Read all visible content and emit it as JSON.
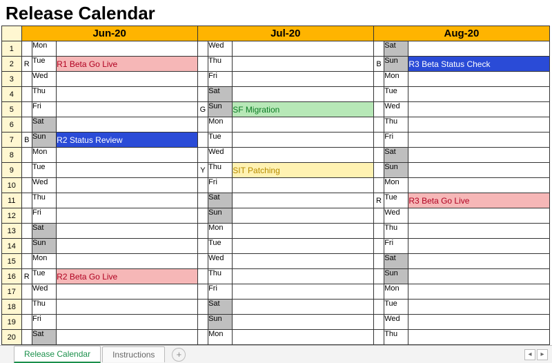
{
  "title": "Release Calendar",
  "months": {
    "m1": "Jun-20",
    "m2": "Jul-20",
    "m3": "Aug-20"
  },
  "rows": [
    {
      "n": "1",
      "c1": {
        "tag": "",
        "dow": "Mon",
        "we": false,
        "ev": "",
        "cls": ""
      },
      "c2": {
        "tag": "",
        "dow": "Wed",
        "we": false,
        "ev": "",
        "cls": ""
      },
      "c3": {
        "tag": "",
        "dow": "Sat",
        "we": true,
        "ev": "",
        "cls": ""
      }
    },
    {
      "n": "2",
      "c1": {
        "tag": "R",
        "dow": "Tue",
        "we": false,
        "ev": "R1 Beta Go Live",
        "cls": "ev-red"
      },
      "c2": {
        "tag": "",
        "dow": "Thu",
        "we": false,
        "ev": "",
        "cls": ""
      },
      "c3": {
        "tag": "B",
        "dow": "Sun",
        "we": true,
        "ev": "R3 Beta Status Check",
        "cls": "ev-blue"
      }
    },
    {
      "n": "3",
      "c1": {
        "tag": "",
        "dow": "Wed",
        "we": false,
        "ev": "",
        "cls": ""
      },
      "c2": {
        "tag": "",
        "dow": "Fri",
        "we": false,
        "ev": "",
        "cls": ""
      },
      "c3": {
        "tag": "",
        "dow": "Mon",
        "we": false,
        "ev": "",
        "cls": ""
      }
    },
    {
      "n": "4",
      "c1": {
        "tag": "",
        "dow": "Thu",
        "we": false,
        "ev": "",
        "cls": ""
      },
      "c2": {
        "tag": "",
        "dow": "Sat",
        "we": true,
        "ev": "",
        "cls": ""
      },
      "c3": {
        "tag": "",
        "dow": "Tue",
        "we": false,
        "ev": "",
        "cls": ""
      }
    },
    {
      "n": "5",
      "c1": {
        "tag": "",
        "dow": "Fri",
        "we": false,
        "ev": "",
        "cls": ""
      },
      "c2": {
        "tag": "G",
        "dow": "Sun",
        "we": true,
        "ev": "SF Migration",
        "cls": "ev-green"
      },
      "c3": {
        "tag": "",
        "dow": "Wed",
        "we": false,
        "ev": "",
        "cls": ""
      }
    },
    {
      "n": "6",
      "c1": {
        "tag": "",
        "dow": "Sat",
        "we": true,
        "ev": "",
        "cls": ""
      },
      "c2": {
        "tag": "",
        "dow": "Mon",
        "we": false,
        "ev": "",
        "cls": ""
      },
      "c3": {
        "tag": "",
        "dow": "Thu",
        "we": false,
        "ev": "",
        "cls": ""
      }
    },
    {
      "n": "7",
      "c1": {
        "tag": "B",
        "dow": "Sun",
        "we": true,
        "ev": "R2 Status Review",
        "cls": "ev-blue"
      },
      "c2": {
        "tag": "",
        "dow": "Tue",
        "we": false,
        "ev": "",
        "cls": ""
      },
      "c3": {
        "tag": "",
        "dow": "Fri",
        "we": false,
        "ev": "",
        "cls": ""
      }
    },
    {
      "n": "8",
      "c1": {
        "tag": "",
        "dow": "Mon",
        "we": false,
        "ev": "",
        "cls": ""
      },
      "c2": {
        "tag": "",
        "dow": "Wed",
        "we": false,
        "ev": "",
        "cls": ""
      },
      "c3": {
        "tag": "",
        "dow": "Sat",
        "we": true,
        "ev": "",
        "cls": ""
      }
    },
    {
      "n": "9",
      "c1": {
        "tag": "",
        "dow": "Tue",
        "we": false,
        "ev": "",
        "cls": ""
      },
      "c2": {
        "tag": "Y",
        "dow": "Thu",
        "we": false,
        "ev": "SIT Patching",
        "cls": "ev-yellow"
      },
      "c3": {
        "tag": "",
        "dow": "Sun",
        "we": true,
        "ev": "",
        "cls": ""
      }
    },
    {
      "n": "10",
      "c1": {
        "tag": "",
        "dow": "Wed",
        "we": false,
        "ev": "",
        "cls": ""
      },
      "c2": {
        "tag": "",
        "dow": "Fri",
        "we": false,
        "ev": "",
        "cls": ""
      },
      "c3": {
        "tag": "",
        "dow": "Mon",
        "we": false,
        "ev": "",
        "cls": ""
      }
    },
    {
      "n": "11",
      "c1": {
        "tag": "",
        "dow": "Thu",
        "we": false,
        "ev": "",
        "cls": ""
      },
      "c2": {
        "tag": "",
        "dow": "Sat",
        "we": true,
        "ev": "",
        "cls": ""
      },
      "c3": {
        "tag": "R",
        "dow": "Tue",
        "we": false,
        "ev": "R3 Beta Go Live",
        "cls": "ev-red"
      }
    },
    {
      "n": "12",
      "c1": {
        "tag": "",
        "dow": "Fri",
        "we": false,
        "ev": "",
        "cls": ""
      },
      "c2": {
        "tag": "",
        "dow": "Sun",
        "we": true,
        "ev": "",
        "cls": ""
      },
      "c3": {
        "tag": "",
        "dow": "Wed",
        "we": false,
        "ev": "",
        "cls": ""
      }
    },
    {
      "n": "13",
      "c1": {
        "tag": "",
        "dow": "Sat",
        "we": true,
        "ev": "",
        "cls": ""
      },
      "c2": {
        "tag": "",
        "dow": "Mon",
        "we": false,
        "ev": "",
        "cls": ""
      },
      "c3": {
        "tag": "",
        "dow": "Thu",
        "we": false,
        "ev": "",
        "cls": ""
      }
    },
    {
      "n": "14",
      "c1": {
        "tag": "",
        "dow": "Sun",
        "we": true,
        "ev": "",
        "cls": ""
      },
      "c2": {
        "tag": "",
        "dow": "Tue",
        "we": false,
        "ev": "",
        "cls": ""
      },
      "c3": {
        "tag": "",
        "dow": "Fri",
        "we": false,
        "ev": "",
        "cls": ""
      }
    },
    {
      "n": "15",
      "c1": {
        "tag": "",
        "dow": "Mon",
        "we": false,
        "ev": "",
        "cls": ""
      },
      "c2": {
        "tag": "",
        "dow": "Wed",
        "we": false,
        "ev": "",
        "cls": ""
      },
      "c3": {
        "tag": "",
        "dow": "Sat",
        "we": true,
        "ev": "",
        "cls": ""
      }
    },
    {
      "n": "16",
      "c1": {
        "tag": "R",
        "dow": "Tue",
        "we": false,
        "ev": "R2 Beta Go Live",
        "cls": "ev-red"
      },
      "c2": {
        "tag": "",
        "dow": "Thu",
        "we": false,
        "ev": "",
        "cls": ""
      },
      "c3": {
        "tag": "",
        "dow": "Sun",
        "we": true,
        "ev": "",
        "cls": ""
      }
    },
    {
      "n": "17",
      "c1": {
        "tag": "",
        "dow": "Wed",
        "we": false,
        "ev": "",
        "cls": ""
      },
      "c2": {
        "tag": "",
        "dow": "Fri",
        "we": false,
        "ev": "",
        "cls": ""
      },
      "c3": {
        "tag": "",
        "dow": "Mon",
        "we": false,
        "ev": "",
        "cls": ""
      }
    },
    {
      "n": "18",
      "c1": {
        "tag": "",
        "dow": "Thu",
        "we": false,
        "ev": "",
        "cls": ""
      },
      "c2": {
        "tag": "",
        "dow": "Sat",
        "we": true,
        "ev": "",
        "cls": ""
      },
      "c3": {
        "tag": "",
        "dow": "Tue",
        "we": false,
        "ev": "",
        "cls": ""
      }
    },
    {
      "n": "19",
      "c1": {
        "tag": "",
        "dow": "Fri",
        "we": false,
        "ev": "",
        "cls": ""
      },
      "c2": {
        "tag": "",
        "dow": "Sun",
        "we": true,
        "ev": "",
        "cls": ""
      },
      "c3": {
        "tag": "",
        "dow": "Wed",
        "we": false,
        "ev": "",
        "cls": ""
      }
    },
    {
      "n": "20",
      "c1": {
        "tag": "",
        "dow": "Sat",
        "we": true,
        "ev": "",
        "cls": ""
      },
      "c2": {
        "tag": "",
        "dow": "Mon",
        "we": false,
        "ev": "",
        "cls": ""
      },
      "c3": {
        "tag": "",
        "dow": "Thu",
        "we": false,
        "ev": "",
        "cls": ""
      }
    }
  ],
  "tabs": {
    "active": "Release Calendar",
    "other": "Instructions",
    "add": "+"
  },
  "scroll": {
    "left": "◂",
    "right": "▸"
  }
}
